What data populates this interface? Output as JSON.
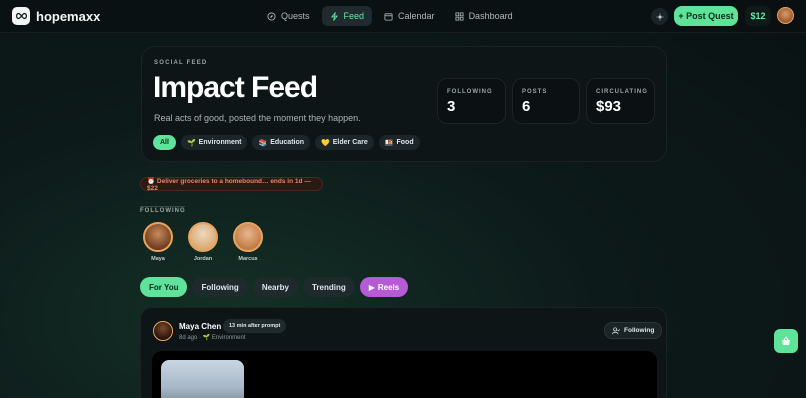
{
  "app": {
    "name": "hopemaxx"
  },
  "nav": {
    "links": [
      {
        "label": "Quests",
        "icon": "compass-icon",
        "active": false
      },
      {
        "label": "Feed",
        "icon": "bolt-icon",
        "active": true
      },
      {
        "label": "Calendar",
        "icon": "calendar-icon",
        "active": false
      },
      {
        "label": "Dashboard",
        "icon": "dashboard-icon",
        "active": false
      }
    ],
    "post_quest_label": "+ Post Quest",
    "wallet_balance": "$12"
  },
  "hero": {
    "eyebrow": "SOCIAL FEED",
    "title": "Impact Feed",
    "subtitle": "Real acts of good, posted the moment they happen.",
    "chips": [
      {
        "label": "All",
        "icon": "",
        "active": true
      },
      {
        "label": "Environment",
        "icon": "🌱",
        "active": false
      },
      {
        "label": "Education",
        "icon": "📚",
        "active": false
      },
      {
        "label": "Elder Care",
        "icon": "💛",
        "active": false
      },
      {
        "label": "Food",
        "icon": "🍱",
        "active": false
      }
    ],
    "stats": [
      {
        "label": "FOLLOWING",
        "value": "3"
      },
      {
        "label": "POSTS",
        "value": "6"
      },
      {
        "label": "CIRCULATING",
        "value": "$93"
      }
    ]
  },
  "urgent_banner": "⏰ Deliver groceries to a homebound… ends in 1d — $22",
  "following": {
    "heading": "FOLLOWING",
    "people": [
      {
        "name": "Maya"
      },
      {
        "name": "Jordan"
      },
      {
        "name": "Marcus"
      }
    ]
  },
  "tabs": [
    {
      "label": "For You",
      "active": true
    },
    {
      "label": "Following",
      "active": false
    },
    {
      "label": "Nearby",
      "active": false
    },
    {
      "label": "Trending",
      "active": false
    },
    {
      "label": "Reels",
      "active": false
    }
  ],
  "post": {
    "author": "Maya Chen",
    "badge": "13 min after prompt",
    "meta": "8d ago · 🌱 Environment",
    "follow_label": "Following"
  },
  "colors": {
    "accent": "#5fe39a",
    "reels": "#b65ad6",
    "warning": "#e08a6a"
  }
}
